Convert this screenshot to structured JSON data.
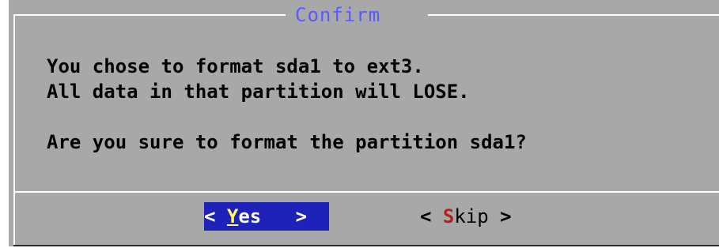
{
  "dialog": {
    "title": "Confirm",
    "message_line1": "You chose to format sda1 to ext3.",
    "message_line2": "All data in that partition will LOSE.",
    "message_line3": "Are you sure to format the partition sda1?"
  },
  "buttons": {
    "yes": {
      "left_bracket": "<",
      "hotkey": "Y",
      "rest": "es",
      "right_bracket": ">",
      "selected": true
    },
    "skip": {
      "left_bracket": "<",
      "hotkey": "S",
      "rest": "kip",
      "right_bracket": ">",
      "selected": false
    }
  },
  "colors": {
    "dialog_background": "#a8a8a8",
    "title": "#5a5aff",
    "selected_button_bg": "#1e22b8",
    "selected_hotkey": "#ffff55",
    "unselected_hotkey": "#b02020"
  }
}
